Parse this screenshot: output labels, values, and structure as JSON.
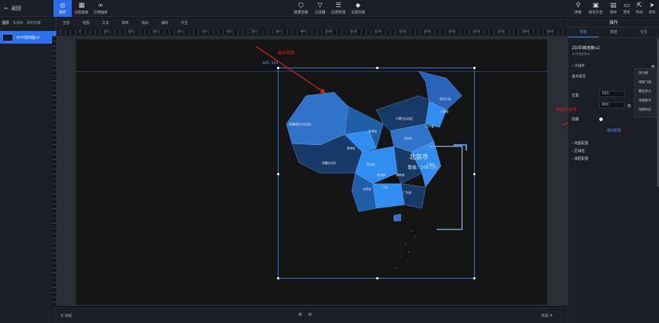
{
  "topbar": {
    "back_label": "返回",
    "left_tools": [
      {
        "label": "组件",
        "icon": "component-icon",
        "active": true
      },
      {
        "label": "动态面板",
        "icon": "panel-icon",
        "active": false
      },
      {
        "label": "引用面板",
        "icon": "link-icon",
        "active": false
      }
    ],
    "center_tools": [
      {
        "label": "数据容器",
        "icon": "cube-icon"
      },
      {
        "label": "过滤器",
        "icon": "filter-icon"
      },
      {
        "label": "回调管理",
        "icon": "sliders-icon"
      },
      {
        "label": "主题风格",
        "icon": "theme-icon"
      }
    ],
    "right_tools": [
      {
        "label": "搜索",
        "icon": "search-icon"
      },
      {
        "label": "版本历史",
        "icon": "history-icon"
      },
      {
        "label": "保存",
        "icon": "save-icon"
      },
      {
        "label": "预览",
        "icon": "preview-icon"
      },
      {
        "label": "导出",
        "icon": "export-icon"
      },
      {
        "label": "发布",
        "icon": "publish-icon"
      }
    ]
  },
  "left_panel": {
    "tabs": [
      "图层",
      "资源库",
      "我的收藏"
    ],
    "layer_name": "2D中国地图v2"
  },
  "canvas_tabs": [
    "全部",
    "地图",
    "文本",
    "媒体",
    "指标",
    "辅助",
    "交互"
  ],
  "ruler_numbers": [
    "0",
    "100",
    "200",
    "300",
    "400",
    "500",
    "600",
    "700",
    "800",
    "900",
    "1000",
    "1100",
    "1200",
    "1300",
    "1400",
    "1500",
    "1600",
    "1700",
    "1800",
    "1900"
  ],
  "canvas": {
    "coord_readout": "923, 116",
    "annotation_select_map": "选中地图",
    "annotation_add_sub": "添加子组件",
    "map_labels": [
      "新疆维吾尔自治区",
      "西藏自治区",
      "青海省",
      "甘肃省",
      "内蒙古自治区",
      "黑龙江省",
      "吉林省",
      "辽宁省",
      "四川省",
      "云南省",
      "广西",
      "广东省",
      "湖南省",
      "贵州省",
      "北京市",
      "上海市"
    ],
    "map_big_label": "北京市",
    "map_value_label": "数值：100 (万)"
  },
  "bottom": {
    "left_label": "收起",
    "right_label": "收起"
  },
  "right_panel": {
    "header": "操作",
    "tabs": [
      "配置",
      "数据",
      "交互"
    ],
    "component_title": "2D中国地图v2",
    "component_subtitle": "2D中国地图v2",
    "sub_component_label": "子组件",
    "basic_props_label": "基本属性",
    "position_label": "位置",
    "position_x": "923",
    "position_y": "116",
    "size_w": "800",
    "size_h": "800",
    "size_unit": "高",
    "opacity_label": "隐藏",
    "config_link": "基础配置",
    "sections": [
      "地图配置",
      "区域名",
      "弹框配置"
    ],
    "dropdown_items": [
      "热力图",
      "地图飞线",
      "聚合热力",
      "地图散点",
      "地图标志"
    ]
  },
  "colors": {
    "accent": "#2c6bec",
    "annotation_red": "#d82828",
    "map_dark": "#173a66",
    "map_light": "#2f8ef0"
  }
}
